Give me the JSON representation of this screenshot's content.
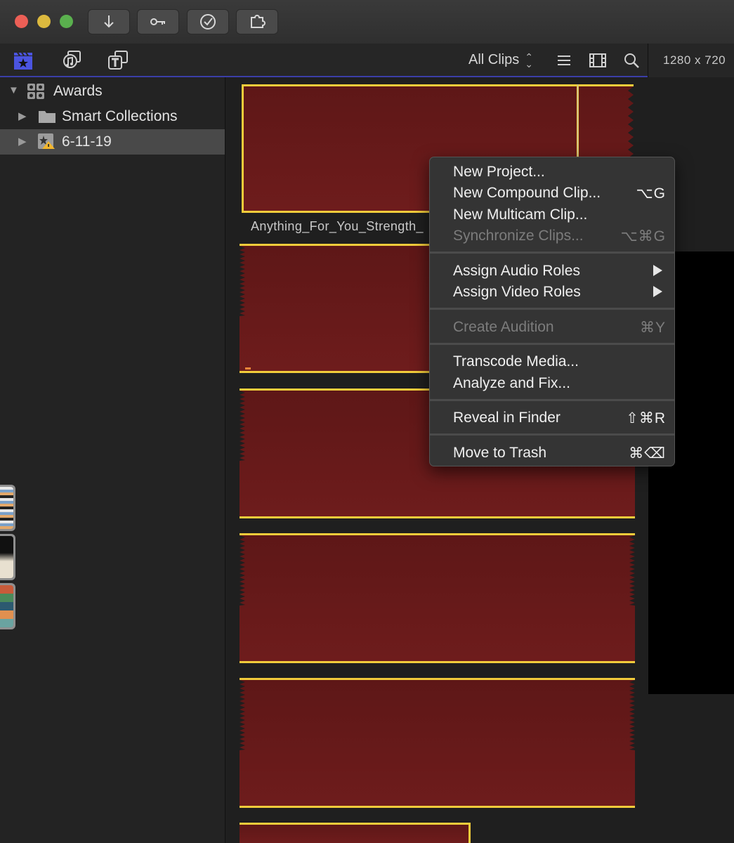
{
  "titlebar": {
    "buttons": [
      {
        "name": "import-button",
        "icon": "down-arrow-icon"
      },
      {
        "name": "keywords-button",
        "icon": "key-icon"
      },
      {
        "name": "background-tasks-button",
        "icon": "checkmark-circle-icon"
      },
      {
        "name": "share-button",
        "icon": "puzzle-icon"
      }
    ]
  },
  "toolbar": {
    "icons": [
      "libraries-icon",
      "photos-audio-icon",
      "titles-generators-icon"
    ],
    "filter_label": "All Clips",
    "right_icons": [
      "list-view-icon",
      "filmstrip-view-icon",
      "search-icon"
    ],
    "resolution": "1280 x 720"
  },
  "sidebar": {
    "items": [
      {
        "label": "Awards",
        "icon": "library-icon",
        "expanded": true
      },
      {
        "label": "Smart Collections",
        "icon": "folder-icon",
        "expanded": false
      },
      {
        "label": "6-11-19",
        "icon": "event-warning-icon",
        "expanded": false,
        "selected": true
      }
    ]
  },
  "browser": {
    "clip_name": "Anything_For_You_Strength_"
  },
  "context_menu": {
    "groups": [
      [
        {
          "label": "New Project...",
          "shortcut": "",
          "enabled": true
        },
        {
          "label": "New Compound Clip...",
          "shortcut": "⌥G",
          "enabled": true
        },
        {
          "label": "New Multicam Clip...",
          "shortcut": "",
          "enabled": true
        },
        {
          "label": "Synchronize Clips...",
          "shortcut": "⌥⌘G",
          "enabled": false
        }
      ],
      [
        {
          "label": "Assign Audio Roles",
          "submenu": true,
          "enabled": true
        },
        {
          "label": "Assign Video Roles",
          "submenu": true,
          "enabled": true
        }
      ],
      [
        {
          "label": "Create Audition",
          "shortcut": "⌘Y",
          "enabled": false
        }
      ],
      [
        {
          "label": "Transcode Media...",
          "shortcut": "",
          "enabled": true
        },
        {
          "label": "Analyze and Fix...",
          "shortcut": "",
          "enabled": true
        }
      ],
      [
        {
          "label": "Reveal in Finder",
          "shortcut": "⇧⌘R",
          "enabled": true
        }
      ],
      [
        {
          "label": "Move to Trash",
          "shortcut": "⌘⌫",
          "enabled": true
        }
      ]
    ]
  },
  "colors": {
    "clip_fill": "#6a1b1b",
    "clip_border": "#f2cc3b",
    "selection_accent": "#3b3ea8"
  }
}
